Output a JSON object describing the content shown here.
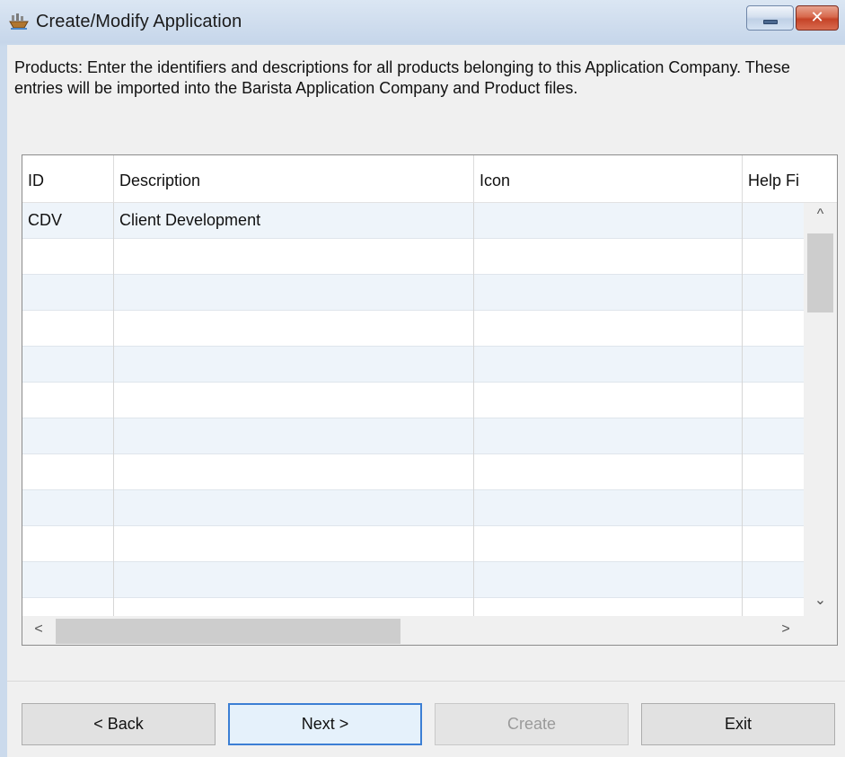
{
  "window": {
    "title": "Create/Modify Application",
    "close_glyph": "✕",
    "icons": {
      "app": "app-ship-icon",
      "minimize": "minimize-icon",
      "close": "close-icon"
    }
  },
  "instructions": "Products: Enter the identifiers and descriptions for all products belonging to this Application Company.  These entries will be imported into the Barista Application Company and Product files.",
  "grid": {
    "columns": [
      "ID",
      "Description",
      "Icon",
      "Help Fi"
    ],
    "rows": [
      [
        "CDV",
        "Client Development",
        "",
        ""
      ],
      [
        "",
        "",
        "",
        ""
      ],
      [
        "",
        "",
        "",
        ""
      ],
      [
        "",
        "",
        "",
        ""
      ],
      [
        "",
        "",
        "",
        ""
      ],
      [
        "",
        "",
        "",
        ""
      ],
      [
        "",
        "",
        "",
        ""
      ],
      [
        "",
        "",
        "",
        ""
      ],
      [
        "",
        "",
        "",
        ""
      ],
      [
        "",
        "",
        "",
        ""
      ],
      [
        "",
        "",
        "",
        ""
      ],
      [
        "",
        "",
        "",
        ""
      ]
    ],
    "scroll_glyphs": {
      "up": "^",
      "down": "⌄",
      "left": "<",
      "right": ">"
    }
  },
  "buttons": {
    "back": "< Back",
    "next": "Next >",
    "create": "Create",
    "exit": "Exit"
  }
}
